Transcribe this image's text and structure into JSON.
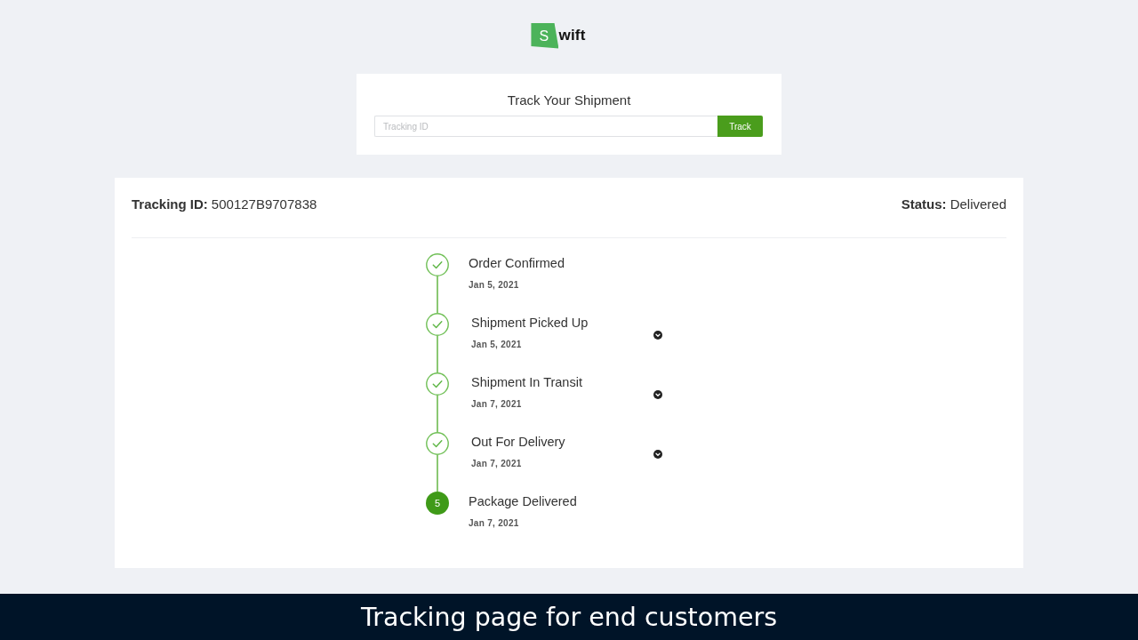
{
  "logo": {
    "mark": "S",
    "text": "wift"
  },
  "search": {
    "title": "Track Your Shipment",
    "placeholder": "Tracking ID",
    "button": "Track"
  },
  "result": {
    "tracking_id": {
      "label": "Tracking ID:",
      "value": "500127B9707838"
    },
    "status": {
      "label": "Status:",
      "value": "Delivered"
    },
    "steps": [
      {
        "title": "Order Confirmed",
        "date": "Jan 5, 2021",
        "kind": "done",
        "expandable": false
      },
      {
        "title": "Shipment Picked Up",
        "date": "Jan 5, 2021",
        "kind": "done",
        "expandable": true
      },
      {
        "title": "Shipment In Transit",
        "date": "Jan 7, 2021",
        "kind": "done",
        "expandable": true
      },
      {
        "title": "Out For Delivery",
        "date": "Jan 7, 2021",
        "kind": "done",
        "expandable": true
      },
      {
        "title": "Package Delivered",
        "date": "Jan 7, 2021",
        "kind": "current",
        "number": "5",
        "expandable": false
      }
    ]
  },
  "caption": "Tracking page for end customers"
}
